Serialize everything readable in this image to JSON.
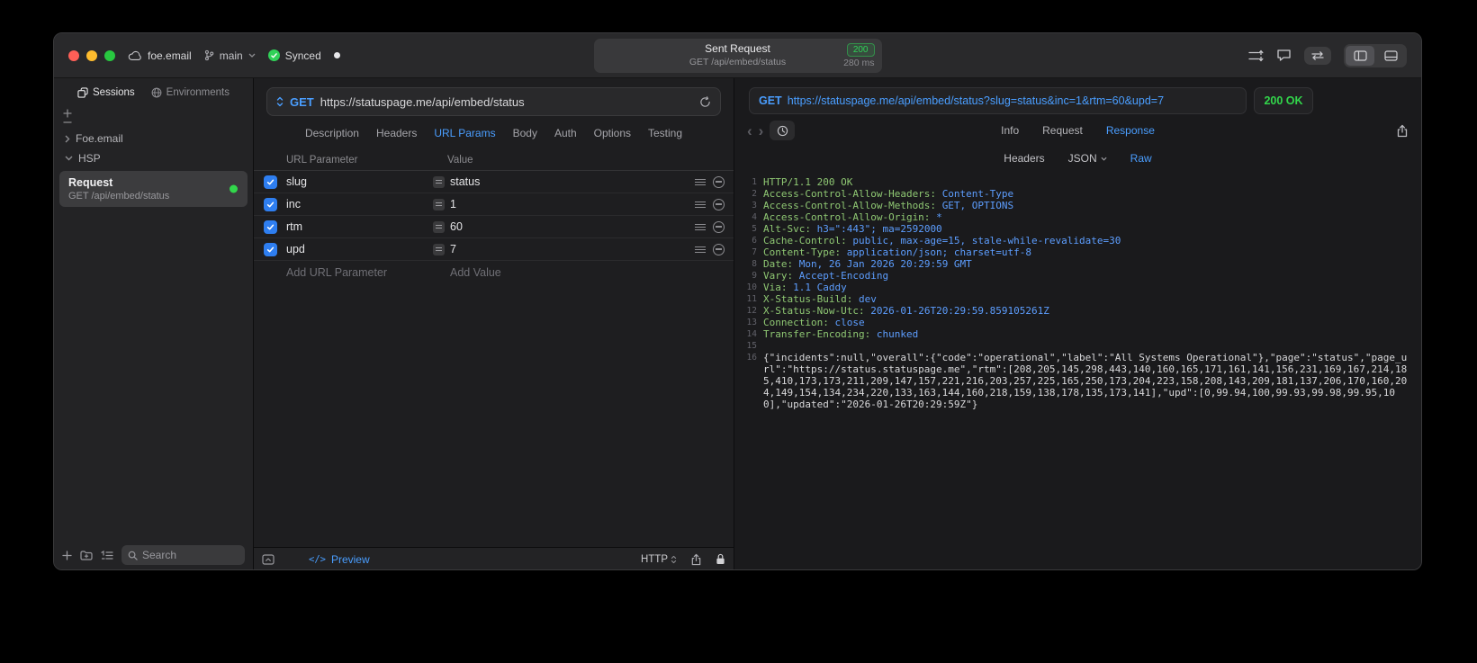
{
  "titlebar": {
    "project": "foe.email",
    "branch": "main",
    "sync_label": "Synced",
    "request_title": "Sent Request",
    "status_badge": "200",
    "request_subtitle": "GET /api/embed/status",
    "duration": "280 ms"
  },
  "sidebar": {
    "tabs": [
      {
        "label": "Sessions",
        "active": true
      },
      {
        "label": "Environments",
        "active": false
      }
    ],
    "tree": [
      {
        "label": "Foe.email",
        "expanded": false
      },
      {
        "label": "HSP",
        "expanded": true
      }
    ],
    "request_item": {
      "title": "Request",
      "subtitle": "GET /api/embed/status"
    },
    "search_placeholder": "Search"
  },
  "request": {
    "method": "GET",
    "url": "https://statuspage.me/api/embed/status",
    "tabs": [
      "Description",
      "Headers",
      "URL Params",
      "Body",
      "Auth",
      "Options",
      "Testing"
    ],
    "active_tab": "URL Params",
    "params": {
      "columns": [
        "URL Parameter",
        "Value"
      ],
      "rows": [
        {
          "name": "slug",
          "value": "status",
          "enabled": true
        },
        {
          "name": "inc",
          "value": "1",
          "enabled": true
        },
        {
          "name": "rtm",
          "value": "60",
          "enabled": true
        },
        {
          "name": "upd",
          "value": "7",
          "enabled": true
        }
      ],
      "add_name_placeholder": "Add URL Parameter",
      "add_value_placeholder": "Add Value"
    },
    "footer": {
      "code_glyph": "</>",
      "preview_label": "Preview",
      "protocol": "HTTP"
    }
  },
  "response": {
    "method": "GET",
    "url": "https://statuspage.me/api/embed/status?slug=status&inc=1&rtm=60&upd=7",
    "status": "200 OK",
    "tabs": [
      "Info",
      "Request",
      "Response"
    ],
    "active_tab": "Response",
    "subtabs": [
      {
        "label": "Headers",
        "dropdown": false
      },
      {
        "label": "JSON",
        "dropdown": true
      },
      {
        "label": "Raw",
        "dropdown": false
      }
    ],
    "active_subtab": "Raw",
    "lines": [
      {
        "n": 1,
        "type": "status",
        "text": "HTTP/1.1 200 OK"
      },
      {
        "n": 2,
        "type": "header",
        "name": "Access-Control-Allow-Headers",
        "value": "Content-Type"
      },
      {
        "n": 3,
        "type": "header",
        "name": "Access-Control-Allow-Methods",
        "value": "GET, OPTIONS"
      },
      {
        "n": 4,
        "type": "header",
        "name": "Access-Control-Allow-Origin",
        "value": "*"
      },
      {
        "n": 5,
        "type": "header",
        "name": "Alt-Svc",
        "value": "h3=\":443\"; ma=2592000"
      },
      {
        "n": 6,
        "type": "header",
        "name": "Cache-Control",
        "value": "public, max-age=15, stale-while-revalidate=30"
      },
      {
        "n": 7,
        "type": "header",
        "name": "Content-Type",
        "value": "application/json; charset=utf-8"
      },
      {
        "n": 8,
        "type": "header",
        "name": "Date",
        "value": "Mon, 26 Jan 2026 20:29:59 GMT"
      },
      {
        "n": 9,
        "type": "header",
        "name": "Vary",
        "value": "Accept-Encoding"
      },
      {
        "n": 10,
        "type": "header",
        "name": "Via",
        "value": "1.1 Caddy"
      },
      {
        "n": 11,
        "type": "header",
        "name": "X-Status-Build",
        "value": "dev"
      },
      {
        "n": 12,
        "type": "header",
        "name": "X-Status-Now-Utc",
        "value": "2026-01-26T20:29:59.859105261Z"
      },
      {
        "n": 13,
        "type": "header",
        "name": "Connection",
        "value": "close"
      },
      {
        "n": 14,
        "type": "header",
        "name": "Transfer-Encoding",
        "value": "chunked"
      },
      {
        "n": 15,
        "type": "blank"
      },
      {
        "n": 16,
        "type": "body",
        "text": "{\"incidents\":null,\"overall\":{\"code\":\"operational\",\"label\":\"All Systems Operational\"},\"page\":\"status\",\"page_url\":\"https://status.statuspage.me\",\"rtm\":[208,205,145,298,443,140,160,165,171,161,141,156,231,169,167,214,185,410,173,173,211,209,147,157,221,216,203,257,225,165,250,173,204,223,158,208,143,209,181,137,206,170,160,204,149,154,134,234,220,133,163,144,160,218,159,138,178,135,173,141],\"upd\":[0,99.94,100,99.93,99.98,99.95,100],\"updated\":\"2026-01-26T20:29:59Z\"}"
      }
    ]
  }
}
